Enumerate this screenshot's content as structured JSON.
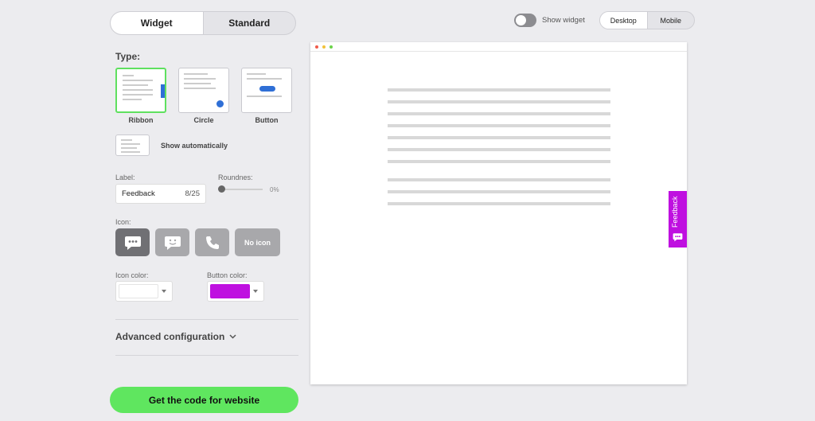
{
  "mode_tabs": [
    {
      "label": "Widget"
    },
    {
      "label": "Standard"
    }
  ],
  "type_section": {
    "title": "Type:",
    "options": [
      {
        "label": "Ribbon"
      },
      {
        "label": "Circle"
      },
      {
        "label": "Button"
      }
    ],
    "selected": "Ribbon",
    "show_auto_label": "Show automatically"
  },
  "label_field": {
    "title": "Label:",
    "value": "Feedback",
    "counter": "8/25"
  },
  "roundness": {
    "title": "Roundnes:",
    "value": "0%"
  },
  "icon_section": {
    "title": "Icon:",
    "options": [
      {
        "name": "chat-bubble-icon"
      },
      {
        "name": "smiley-chat-icon"
      },
      {
        "name": "phone-icon"
      },
      {
        "label": "No icon"
      }
    ],
    "selected_index": 0
  },
  "icon_color": {
    "title": "Icon color:",
    "value": "#ffffff"
  },
  "button_color": {
    "title": "Button color:",
    "value": "#bf10e0"
  },
  "advanced_label": "Advanced configuration",
  "cta_label": "Get the code for website",
  "show_widget": {
    "label": "Show widget",
    "on": false
  },
  "device_tabs": [
    {
      "label": "Desktop"
    },
    {
      "label": "Mobile"
    }
  ],
  "device_selected": "Desktop",
  "preview": {
    "ribbon_label": "Feedback"
  },
  "colors": {
    "accent_green": "#5fe65f",
    "ribbon_purple": "#bf10e0"
  }
}
